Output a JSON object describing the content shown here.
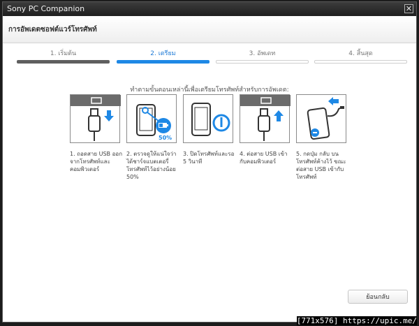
{
  "window": {
    "title": "Sony PC Companion",
    "close_symbol": "✕"
  },
  "header": {
    "title": "การอัพเดตซอฟต์แวร์โทรศัพท์"
  },
  "steps": [
    {
      "label": "1. เริ่มต้น",
      "state": "done"
    },
    {
      "label": "2. เตรียม",
      "state": "active"
    },
    {
      "label": "3. อัพเดท",
      "state": "future"
    },
    {
      "label": "4. สิ้นสุด",
      "state": "future"
    }
  ],
  "instruction": "ทำตามขั้นตอนเหล่านี้เพื่อเตรียมโทรศัพท์สำหรับการอัพเดต:",
  "cards": [
    {
      "icon": "usb-unplug-icon",
      "caption": "1. ถอดสาย USB ออกจากโทรศัพท์และคอมพิวเตอร์"
    },
    {
      "icon": "phone-battery-icon",
      "badge": "50%",
      "caption": "2. ตรวจดูให้แน่ใจว่าได้ชาร์จแบตเตอรี่โทรศัพท์ไว้อย่างน้อย 50%"
    },
    {
      "icon": "phone-power-off-icon",
      "caption": "3. ปิดโทรศัพท์และรอ 5 วินาที"
    },
    {
      "icon": "usb-plug-icon",
      "caption": "4. ต่อสาย USB เข้ากับคอมพิวเตอร์"
    },
    {
      "icon": "phone-connect-button-icon",
      "caption": "5. กดปุ่ม กลับ บนโทรศัพท์ค้างไว้ ขณะต่อสาย USB เข้ากับโทรศัพท์"
    }
  ],
  "buttons": {
    "back_label": "ย้อนกลับ"
  },
  "colors": {
    "accent": "#1e88e5",
    "done": "#5f5f5f"
  },
  "watermark": "[771x576] https://upic.me/"
}
